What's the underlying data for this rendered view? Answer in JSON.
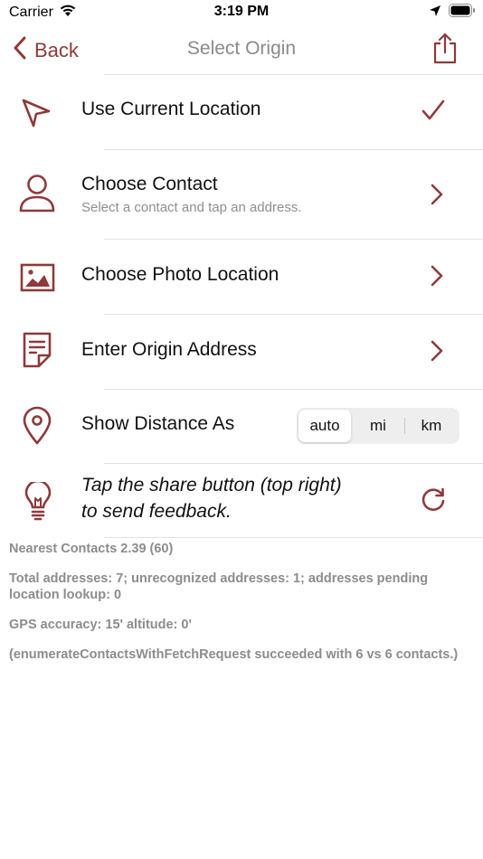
{
  "status": {
    "carrier": "Carrier",
    "time": "3:19 PM"
  },
  "nav": {
    "back_label": "Back",
    "title": "Select Origin"
  },
  "rows": {
    "current_location": {
      "title": "Use Current Location"
    },
    "contact": {
      "title": "Choose Contact",
      "subtitle": "Select a contact and tap an address."
    },
    "photo": {
      "title": "Choose Photo Location"
    },
    "address": {
      "title": "Enter Origin Address"
    },
    "distance": {
      "title": "Show Distance As",
      "options": [
        "auto",
        "mi",
        "km"
      ],
      "selected": "auto"
    },
    "tip": {
      "line1": "Tap the share button (top right)",
      "line2": "to send feedback."
    }
  },
  "info": {
    "version": "Nearest Contacts 2.39 (60)",
    "addresses": "Total addresses: 7; unrecognized addresses: 1; addresses pending location lookup: 0",
    "gps": "GPS accuracy: 15' altitude: 0'",
    "enumerate": "(enumerateContactsWithFetchRequest succeeded with 6 vs 6 contacts.)"
  },
  "colors": {
    "accent": "#8e3a3a",
    "title_gray": "#8a8a8a",
    "info_gray": "#8c8c8c"
  }
}
